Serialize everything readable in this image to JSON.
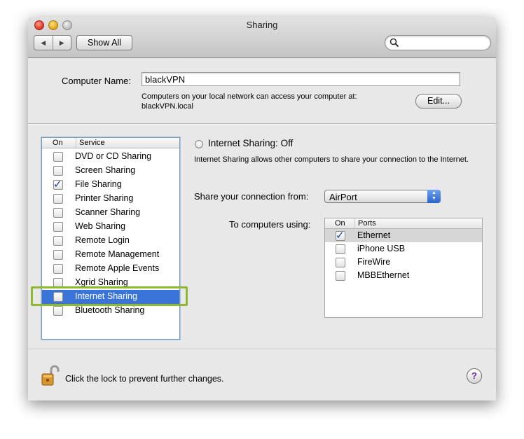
{
  "window": {
    "title": "Sharing"
  },
  "toolbar": {
    "show_all_label": "Show All",
    "back_glyph": "◀",
    "forward_glyph": "▶",
    "search_placeholder": ""
  },
  "computer_name": {
    "label": "Computer Name:",
    "value": "blackVPN",
    "info_line1": "Computers on your local network can access your computer at:",
    "info_line2": "blackVPN.local",
    "edit_label": "Edit..."
  },
  "services": {
    "header_on": "On",
    "header_service": "Service",
    "items": [
      {
        "label": "DVD or CD Sharing",
        "checked": false,
        "selected": false
      },
      {
        "label": "Screen Sharing",
        "checked": false,
        "selected": false
      },
      {
        "label": "File Sharing",
        "checked": true,
        "selected": false
      },
      {
        "label": "Printer Sharing",
        "checked": false,
        "selected": false
      },
      {
        "label": "Scanner Sharing",
        "checked": false,
        "selected": false
      },
      {
        "label": "Web Sharing",
        "checked": false,
        "selected": false
      },
      {
        "label": "Remote Login",
        "checked": false,
        "selected": false
      },
      {
        "label": "Remote Management",
        "checked": false,
        "selected": false
      },
      {
        "label": "Remote Apple Events",
        "checked": false,
        "selected": false
      },
      {
        "label": "Xgrid Sharing",
        "checked": false,
        "selected": false
      },
      {
        "label": "Internet Sharing",
        "checked": false,
        "selected": true
      },
      {
        "label": "Bluetooth Sharing",
        "checked": false,
        "selected": false
      }
    ]
  },
  "detail": {
    "status": "Internet Sharing: Off",
    "description": "Internet Sharing allows other computers to share your connection to the Internet.",
    "share_from_label": "Share your connection from:",
    "share_from_value": "AirPort",
    "to_computers_label": "To computers using:",
    "ports_header_on": "On",
    "ports_header_ports": "Ports",
    "ports": [
      {
        "label": "Ethernet",
        "checked": true,
        "selected": true
      },
      {
        "label": "iPhone USB",
        "checked": false,
        "selected": false
      },
      {
        "label": "FireWire",
        "checked": false,
        "selected": false
      },
      {
        "label": "MBBEthernet",
        "checked": false,
        "selected": false
      }
    ]
  },
  "footer": {
    "lock_text": "Click the lock to prevent further changes.",
    "help_glyph": "?"
  },
  "colors": {
    "selection": "#3a74d8",
    "highlight_box": "#8fb830",
    "window_bg": "#e8e8e8"
  }
}
